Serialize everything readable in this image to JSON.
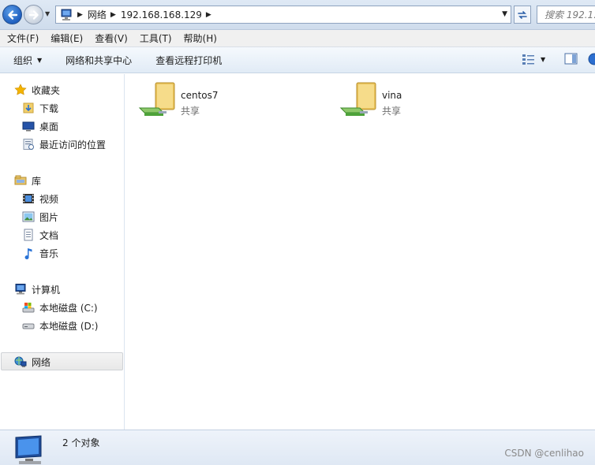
{
  "address": {
    "crumbs": [
      "网络",
      "192.168.168.129"
    ],
    "search_placeholder": "搜索 192.1..."
  },
  "menu": [
    "文件(F)",
    "编辑(E)",
    "查看(V)",
    "工具(T)",
    "帮助(H)"
  ],
  "toolbar": {
    "organize": "组织",
    "network_center": "网络和共享中心",
    "remote_printers": "查看远程打印机"
  },
  "nav": {
    "favorites": "收藏夹",
    "downloads": "下载",
    "desktop": "桌面",
    "recent": "最近访问的位置",
    "libraries": "库",
    "videos": "视频",
    "pictures": "图片",
    "documents": "文档",
    "music": "音乐",
    "computer": "计算机",
    "drive_c": "本地磁盘 (C:)",
    "drive_d": "本地磁盘 (D:)",
    "network": "网络"
  },
  "shares": [
    {
      "name": "centos7",
      "type": "共享"
    },
    {
      "name": "vina",
      "type": "共享"
    }
  ],
  "status": {
    "count": "2 个对象"
  },
  "watermark": "CSDN @cenlihao"
}
